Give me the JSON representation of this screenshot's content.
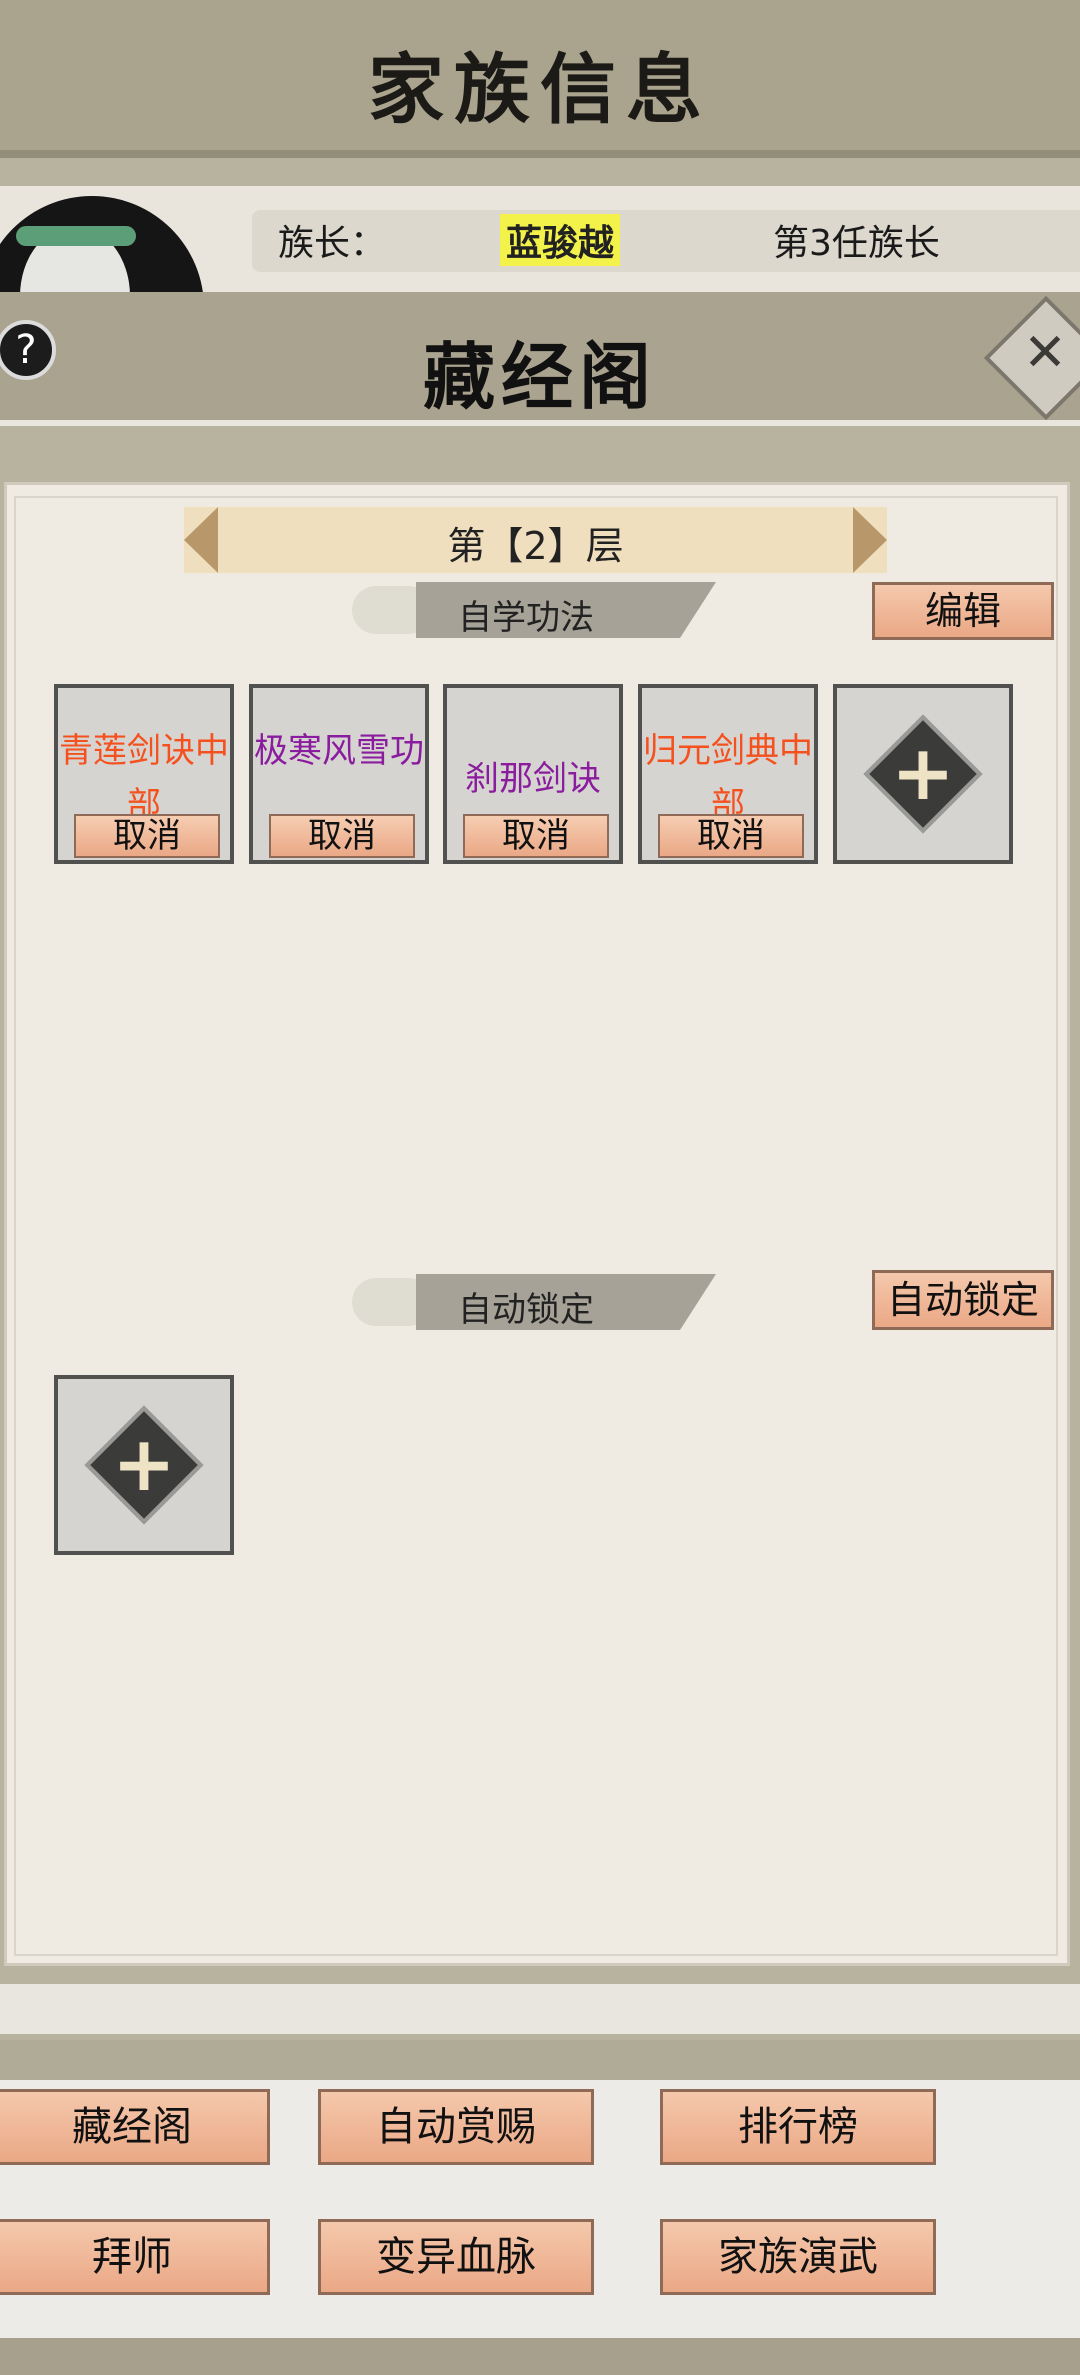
{
  "header": {
    "title": "家族信息"
  },
  "leader": {
    "label": "族长：",
    "name": "蓝骏越",
    "rank": "第3任族长"
  },
  "dialog": {
    "help_label": "?",
    "title": "藏经阁",
    "close_label": "✕",
    "floor": "第【2】层",
    "self_study": {
      "title": "自学功法",
      "edit_label": "编辑",
      "slots": [
        {
          "name": "青莲剑诀中部",
          "color": "#f4511e",
          "cancel": "取消"
        },
        {
          "name": "极寒风雪功",
          "color": "#8a1c9e",
          "cancel": "取消"
        },
        {
          "name": "刹那剑诀",
          "color": "#8a1c9e",
          "cancel": "取消"
        },
        {
          "name": "归元剑典中部",
          "color": "#f4511e",
          "cancel": "取消"
        }
      ],
      "add_icon": "plus-icon"
    },
    "auto_lock": {
      "title": "自动锁定",
      "button_label": "自动锁定",
      "add_icon": "plus-icon"
    }
  },
  "bottom_nav": [
    {
      "label": "藏经阁"
    },
    {
      "label": "自动赏赐"
    },
    {
      "label": "排行榜"
    },
    {
      "label": "拜师"
    },
    {
      "label": "变异血脉"
    },
    {
      "label": "家族演武"
    }
  ],
  "colors": {
    "accent_button": "#eaa886",
    "rare_text": "#f4511e",
    "epic_text": "#8a1c9e"
  }
}
